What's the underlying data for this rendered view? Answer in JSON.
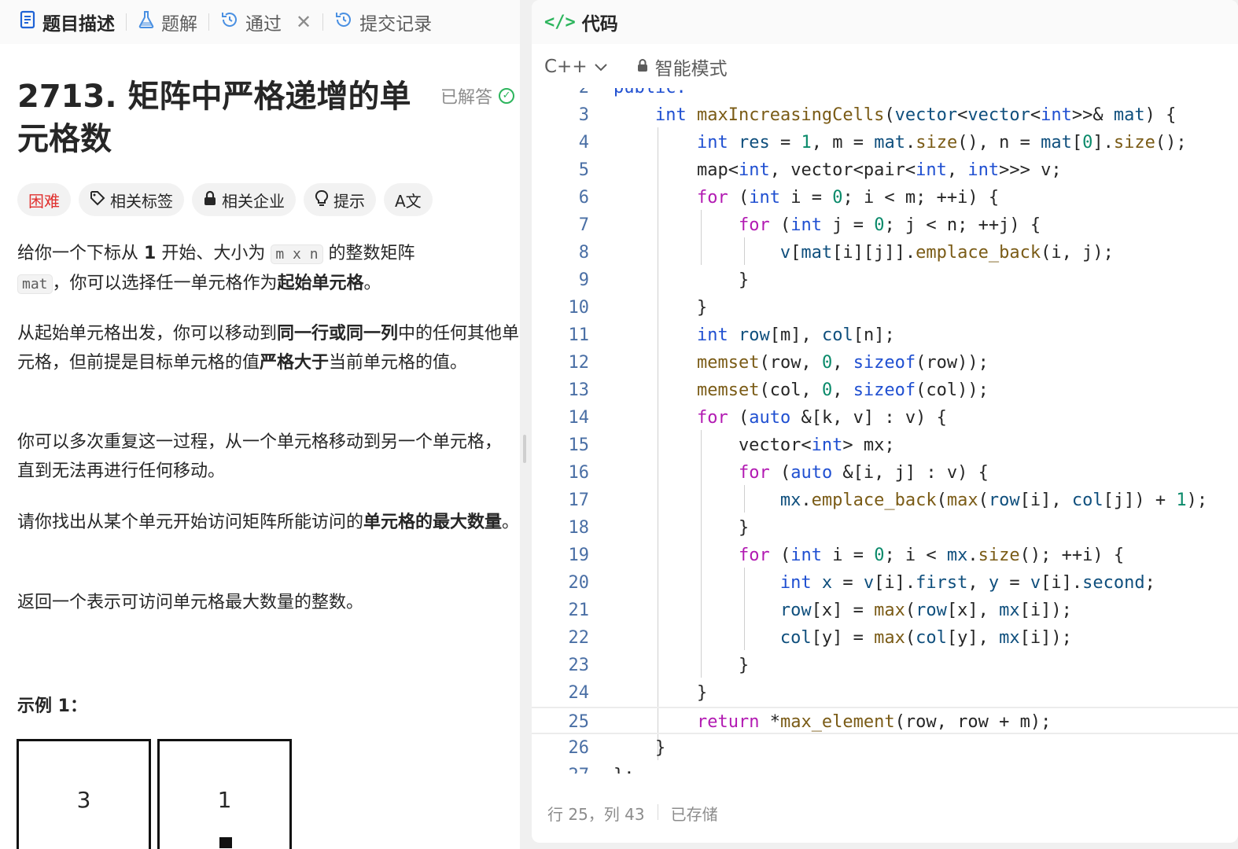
{
  "left_tabs": [
    {
      "label": "题目描述",
      "icon": "doc-icon"
    },
    {
      "label": "题解",
      "icon": "flask-icon"
    },
    {
      "label": "通过",
      "icon": "history-icon"
    },
    {
      "label": "提交记录",
      "icon": "history-icon"
    }
  ],
  "problem": {
    "title": "2713. 矩阵中严格递增的单元格数",
    "status": "已解答",
    "tags": [
      "困难",
      "相关标签",
      "相关企业",
      "提示",
      "A文"
    ],
    "p1_a": "给你一个下标从",
    "p1_num": "1",
    "p1_b": "开始、大小为",
    "p1_code": "m x n",
    "p1_c": "的整数矩阵",
    "p1_code2": "mat",
    "p1_d": "，你可以选择任一单元格作为",
    "p1_bold": "起始单元格",
    "p1_e": "。",
    "p2_a": "从起始单元格出发，你可以移动到",
    "p2_bold1": "同一行或同一列",
    "p2_b": "中的任何其他单元格，但前提是目标单元格的值",
    "p2_bold2": "严格大于",
    "p2_c": "当前单元格的值。",
    "p3": "你可以多次重复这一过程，从一个单元格移动到另一个单元格，直到无法再进行任何移动。",
    "p4_a": "请你找出从某个单元开始访问矩阵所能访问的",
    "p4_bold": "单元格的最大数量",
    "p4_b": "。",
    "p5": "返回一个表示可访问单元格最大数量的整数。",
    "example_label": "示例 1：",
    "example_cells": [
      "3",
      "1"
    ]
  },
  "code_panel": {
    "title": "代码",
    "language": "C++",
    "mode": "智能模式",
    "status_position": "行 25，列 43",
    "status_saved": "已存储"
  }
}
